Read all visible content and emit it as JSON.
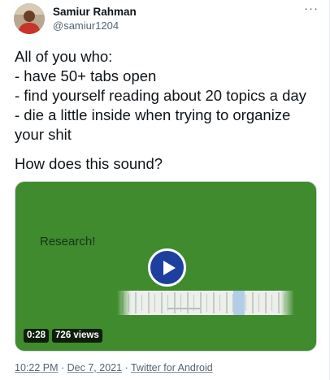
{
  "author": {
    "display_name": "Samiur Rahman",
    "handle": "@samiur1204",
    "avatar_icon": "user-avatar"
  },
  "more_icon": "ellipsis-icon",
  "more_label": "···",
  "tweet": {
    "lines": [
      "All of you who:",
      "- have 50+ tabs open",
      "- find yourself reading about 20 topics a day",
      "- die a little inside when trying to organize",
      "your shit"
    ],
    "question": "How does this sound?"
  },
  "video": {
    "title_text": "Research!",
    "duration": "0:28",
    "views": "726 views",
    "background_color": "#3f8b2e",
    "play_button_color": "#1d3f9e",
    "play_icon": "play-icon"
  },
  "meta": {
    "time": "10:22 PM",
    "separator": "·",
    "date": "Dec 7, 2021",
    "source": "Twitter for Android"
  }
}
